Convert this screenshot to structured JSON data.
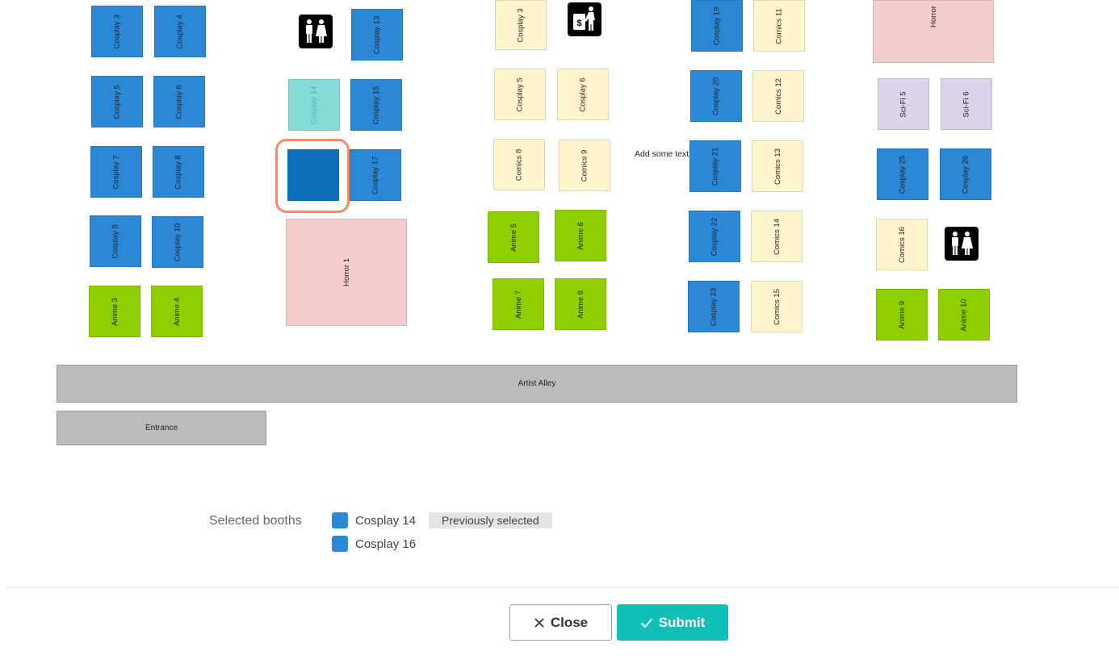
{
  "floor": {
    "booths": [
      {
        "label": "Cosplay 3",
        "color": "blue"
      },
      {
        "label": "Cosplay 4",
        "color": "blue"
      },
      {
        "label": "Cosplay 5",
        "color": "blue"
      },
      {
        "label": "Cosplay 6",
        "color": "blue"
      },
      {
        "label": "Cosplay 7",
        "color": "blue"
      },
      {
        "label": "Cosplay 8",
        "color": "blue"
      },
      {
        "label": "Cosplay 9",
        "color": "blue"
      },
      {
        "label": "Cosplay 10",
        "color": "blue"
      },
      {
        "label": "Anime 3",
        "color": "green"
      },
      {
        "label": "Anime 4",
        "color": "green"
      },
      {
        "label": "Cosplay 13",
        "color": "blue"
      },
      {
        "label": "Cosplay 14",
        "color": "teal",
        "state": "previously-selected"
      },
      {
        "label": "Cosplay 15",
        "color": "blue"
      },
      {
        "label": "Cosplay 16",
        "color": "selected",
        "state": "selected"
      },
      {
        "label": "Cosplay 17",
        "color": "blue"
      },
      {
        "label": "Horror 1",
        "color": "pink"
      },
      {
        "label": "Cosplay 3",
        "color": "cream"
      },
      {
        "label": "Cosplay 5",
        "color": "cream"
      },
      {
        "label": "Cosplay 6",
        "color": "cream"
      },
      {
        "label": "Comics 8",
        "color": "cream"
      },
      {
        "label": "Comics 9",
        "color": "cream"
      },
      {
        "label": "Anime 5",
        "color": "green"
      },
      {
        "label": "Anime 6",
        "color": "green"
      },
      {
        "label": "Anime 7",
        "color": "green"
      },
      {
        "label": "Anime 8",
        "color": "green"
      },
      {
        "label": "Cosplay 19",
        "color": "blue"
      },
      {
        "label": "Comics 11",
        "color": "cream"
      },
      {
        "label": "Cosplay 20",
        "color": "blue"
      },
      {
        "label": "Comics 12",
        "color": "cream"
      },
      {
        "label": "Cosplay 21",
        "color": "blue"
      },
      {
        "label": "Comics 13",
        "color": "cream"
      },
      {
        "label": "Cosplay 22",
        "color": "blue"
      },
      {
        "label": "Comics 14",
        "color": "cream"
      },
      {
        "label": "Cosplay 23",
        "color": "blue"
      },
      {
        "label": "Comics 15",
        "color": "cream"
      },
      {
        "label": "Horror",
        "color": "pink"
      },
      {
        "label": "Sci-Fi 5",
        "color": "lav"
      },
      {
        "label": "Sci-Fi 6",
        "color": "lav"
      },
      {
        "label": "Cosplay 25",
        "color": "blue"
      },
      {
        "label": "Cosplay 26",
        "color": "blue"
      },
      {
        "label": "Comics 16",
        "color": "cream"
      },
      {
        "label": "Anime 9",
        "color": "green"
      },
      {
        "label": "Anime 10",
        "color": "green"
      }
    ],
    "icons": [
      "restroom-icon",
      "atm-icon",
      "restroom-icon"
    ],
    "artist_alley": "Artist Alley",
    "entrance": "Entrance",
    "free_text": "Add some text"
  },
  "selected_booths": {
    "title": "Selected booths",
    "items": [
      {
        "name": "Cosplay 14",
        "badge": "Previously selected"
      },
      {
        "name": "Cosplay 16",
        "badge": ""
      }
    ]
  },
  "footer": {
    "close_label": "Close",
    "submit_label": "Submit"
  },
  "colors": {
    "blue": "#2b88d6",
    "cream": "#fff4cc",
    "green": "#8fcf00",
    "pink": "#f4cccc",
    "lav": "#dad3ea",
    "teal": "#86dcd9",
    "selected": "#0b6fba",
    "highlight": "#f58b5e",
    "submit": "#10c0b8"
  }
}
